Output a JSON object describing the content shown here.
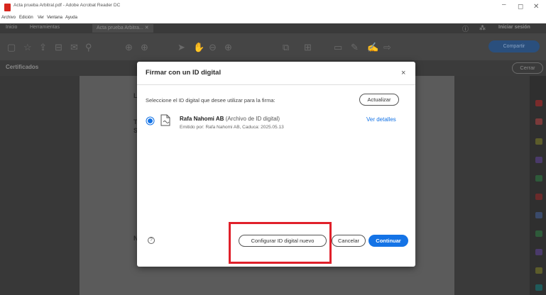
{
  "window": {
    "title": "Acta prueba Arbitral.pdf - Adobe Acrobat Reader DC",
    "minimize": "–",
    "maximize": "◻",
    "close": "✕"
  },
  "menubar": {
    "items": [
      "Archivo",
      "Edición",
      "Ver",
      "Ventana",
      "Ayuda"
    ]
  },
  "tabs": {
    "home": "Inicio",
    "tools": "Herramientas",
    "document": "Acta prueba Arbitra... ✕",
    "signin": "Iniciar sesión"
  },
  "toolbar": {
    "share": "Compartir"
  },
  "certificates": {
    "title": "Certificados",
    "close": "Cerrar"
  },
  "dialog": {
    "title": "Firmar con un ID digital",
    "close": "×",
    "prompt": "Seleccione el ID digital que desee utilizar para la firma:",
    "refresh": "Actualizar",
    "id_name": "Rafa Nahomi AB",
    "id_type": "(Archivo de ID digital)",
    "id_issuer": "Emitido por: Rafa Nahomi AB, Caduca: 2025.05.13",
    "details": "Ver detalles",
    "help": "?",
    "configure": "Configurar ID digital nuevo",
    "cancel": "Cancelar",
    "continue": "Continuar"
  },
  "colors": {
    "accent": "#1473e6",
    "highlight": "#e0202a"
  }
}
